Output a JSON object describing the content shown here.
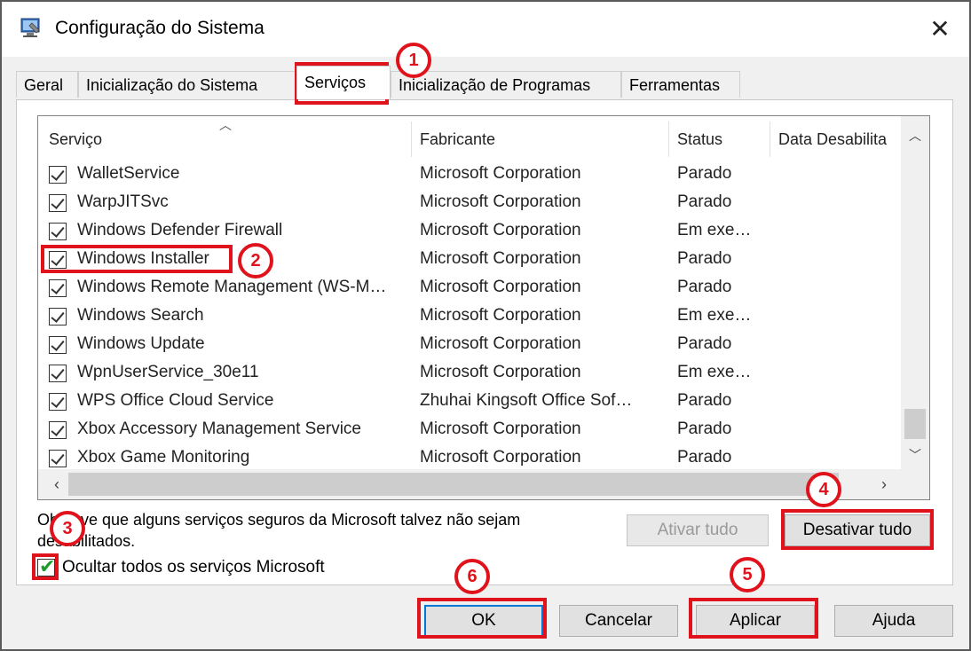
{
  "window": {
    "title": "Configuração do Sistema",
    "close_glyph": "✕"
  },
  "tabs": [
    {
      "label": "Geral"
    },
    {
      "label": "Inicialização do Sistema"
    },
    {
      "label": "Serviços"
    },
    {
      "label": "Inicialização de Programas"
    },
    {
      "label": "Ferramentas"
    }
  ],
  "active_tab": "Serviços",
  "table": {
    "headers": [
      "Serviço",
      "Fabricante",
      "Status",
      "Data Desabilita"
    ],
    "rows": [
      {
        "name": "WalletService",
        "vendor": "Microsoft Corporation",
        "status": "Parado"
      },
      {
        "name": "WarpJITSvc",
        "vendor": "Microsoft Corporation",
        "status": "Parado"
      },
      {
        "name": "Windows Defender Firewall",
        "vendor": "Microsoft Corporation",
        "status": "Em exe…"
      },
      {
        "name": "Windows Installer",
        "vendor": "Microsoft Corporation",
        "status": "Parado"
      },
      {
        "name": "Windows Remote Management (WS-M…",
        "vendor": "Microsoft Corporation",
        "status": "Parado"
      },
      {
        "name": "Windows Search",
        "vendor": "Microsoft Corporation",
        "status": "Em exe…"
      },
      {
        "name": "Windows Update",
        "vendor": "Microsoft Corporation",
        "status": "Parado"
      },
      {
        "name": "WpnUserService_30e11",
        "vendor": "Microsoft Corporation",
        "status": "Em exe…"
      },
      {
        "name": "WPS Office Cloud Service",
        "vendor": "Zhuhai Kingsoft Office Sof…",
        "status": "Parado"
      },
      {
        "name": "Xbox Accessory Management Service",
        "vendor": "Microsoft Corporation",
        "status": "Parado"
      },
      {
        "name": "Xbox Game Monitoring",
        "vendor": "Microsoft Corporation",
        "status": "Parado"
      }
    ]
  },
  "note": "Observe que alguns serviços seguros da Microsoft talvez não sejam desabilitados.",
  "buttons": {
    "enable_all": "Ativar tudo",
    "disable_all": "Desativar tudo",
    "ok": "OK",
    "cancel": "Cancelar",
    "apply": "Aplicar",
    "help": "Ajuda"
  },
  "hide_ms": {
    "label": "Ocultar todos os serviços Microsoft",
    "checked": true
  },
  "annotations": [
    "1",
    "2",
    "3",
    "4",
    "5",
    "6"
  ],
  "colors": {
    "annotation": "#e0121c",
    "check_green": "#1a9d2a"
  }
}
